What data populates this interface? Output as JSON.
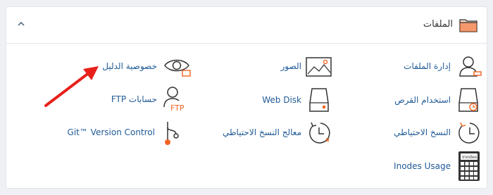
{
  "section": {
    "title": "الملفات",
    "icon": "folder-icon",
    "collapse_icon": "chevron-up-icon"
  },
  "items": {
    "file_manager": {
      "label": "إدارة الملفات",
      "icon": "user-manage-icon"
    },
    "images": {
      "label": "الصور",
      "icon": "image-icon"
    },
    "directory_privacy": {
      "label": "خصوصية الدليل",
      "icon": "eye-privacy-icon"
    },
    "disk_usage": {
      "label": "استخدام القرص",
      "icon": "disk-usage-icon"
    },
    "web_disk": {
      "label": "Web Disk",
      "icon": "web-disk-icon"
    },
    "ftp_accounts": {
      "label": "حسابات FTP",
      "icon": "ftp-user-icon",
      "badge": "FTP"
    },
    "backup": {
      "label": "النسخ الاحتياطي",
      "icon": "backup-clock-icon"
    },
    "backup_wizard": {
      "label": "معالج النسخ الاحتياطي",
      "icon": "backup-wizard-icon"
    },
    "git": {
      "label": "Git™ Version Control",
      "icon": "git-branch-icon"
    },
    "inodes": {
      "label": "Inodes Usage",
      "icon": "calculator-icon",
      "badge": "inodes"
    }
  },
  "colors": {
    "link": "#1f5a96",
    "accent": "#f26522",
    "icon_stroke": "#333333",
    "arrow": "#e8201b"
  }
}
